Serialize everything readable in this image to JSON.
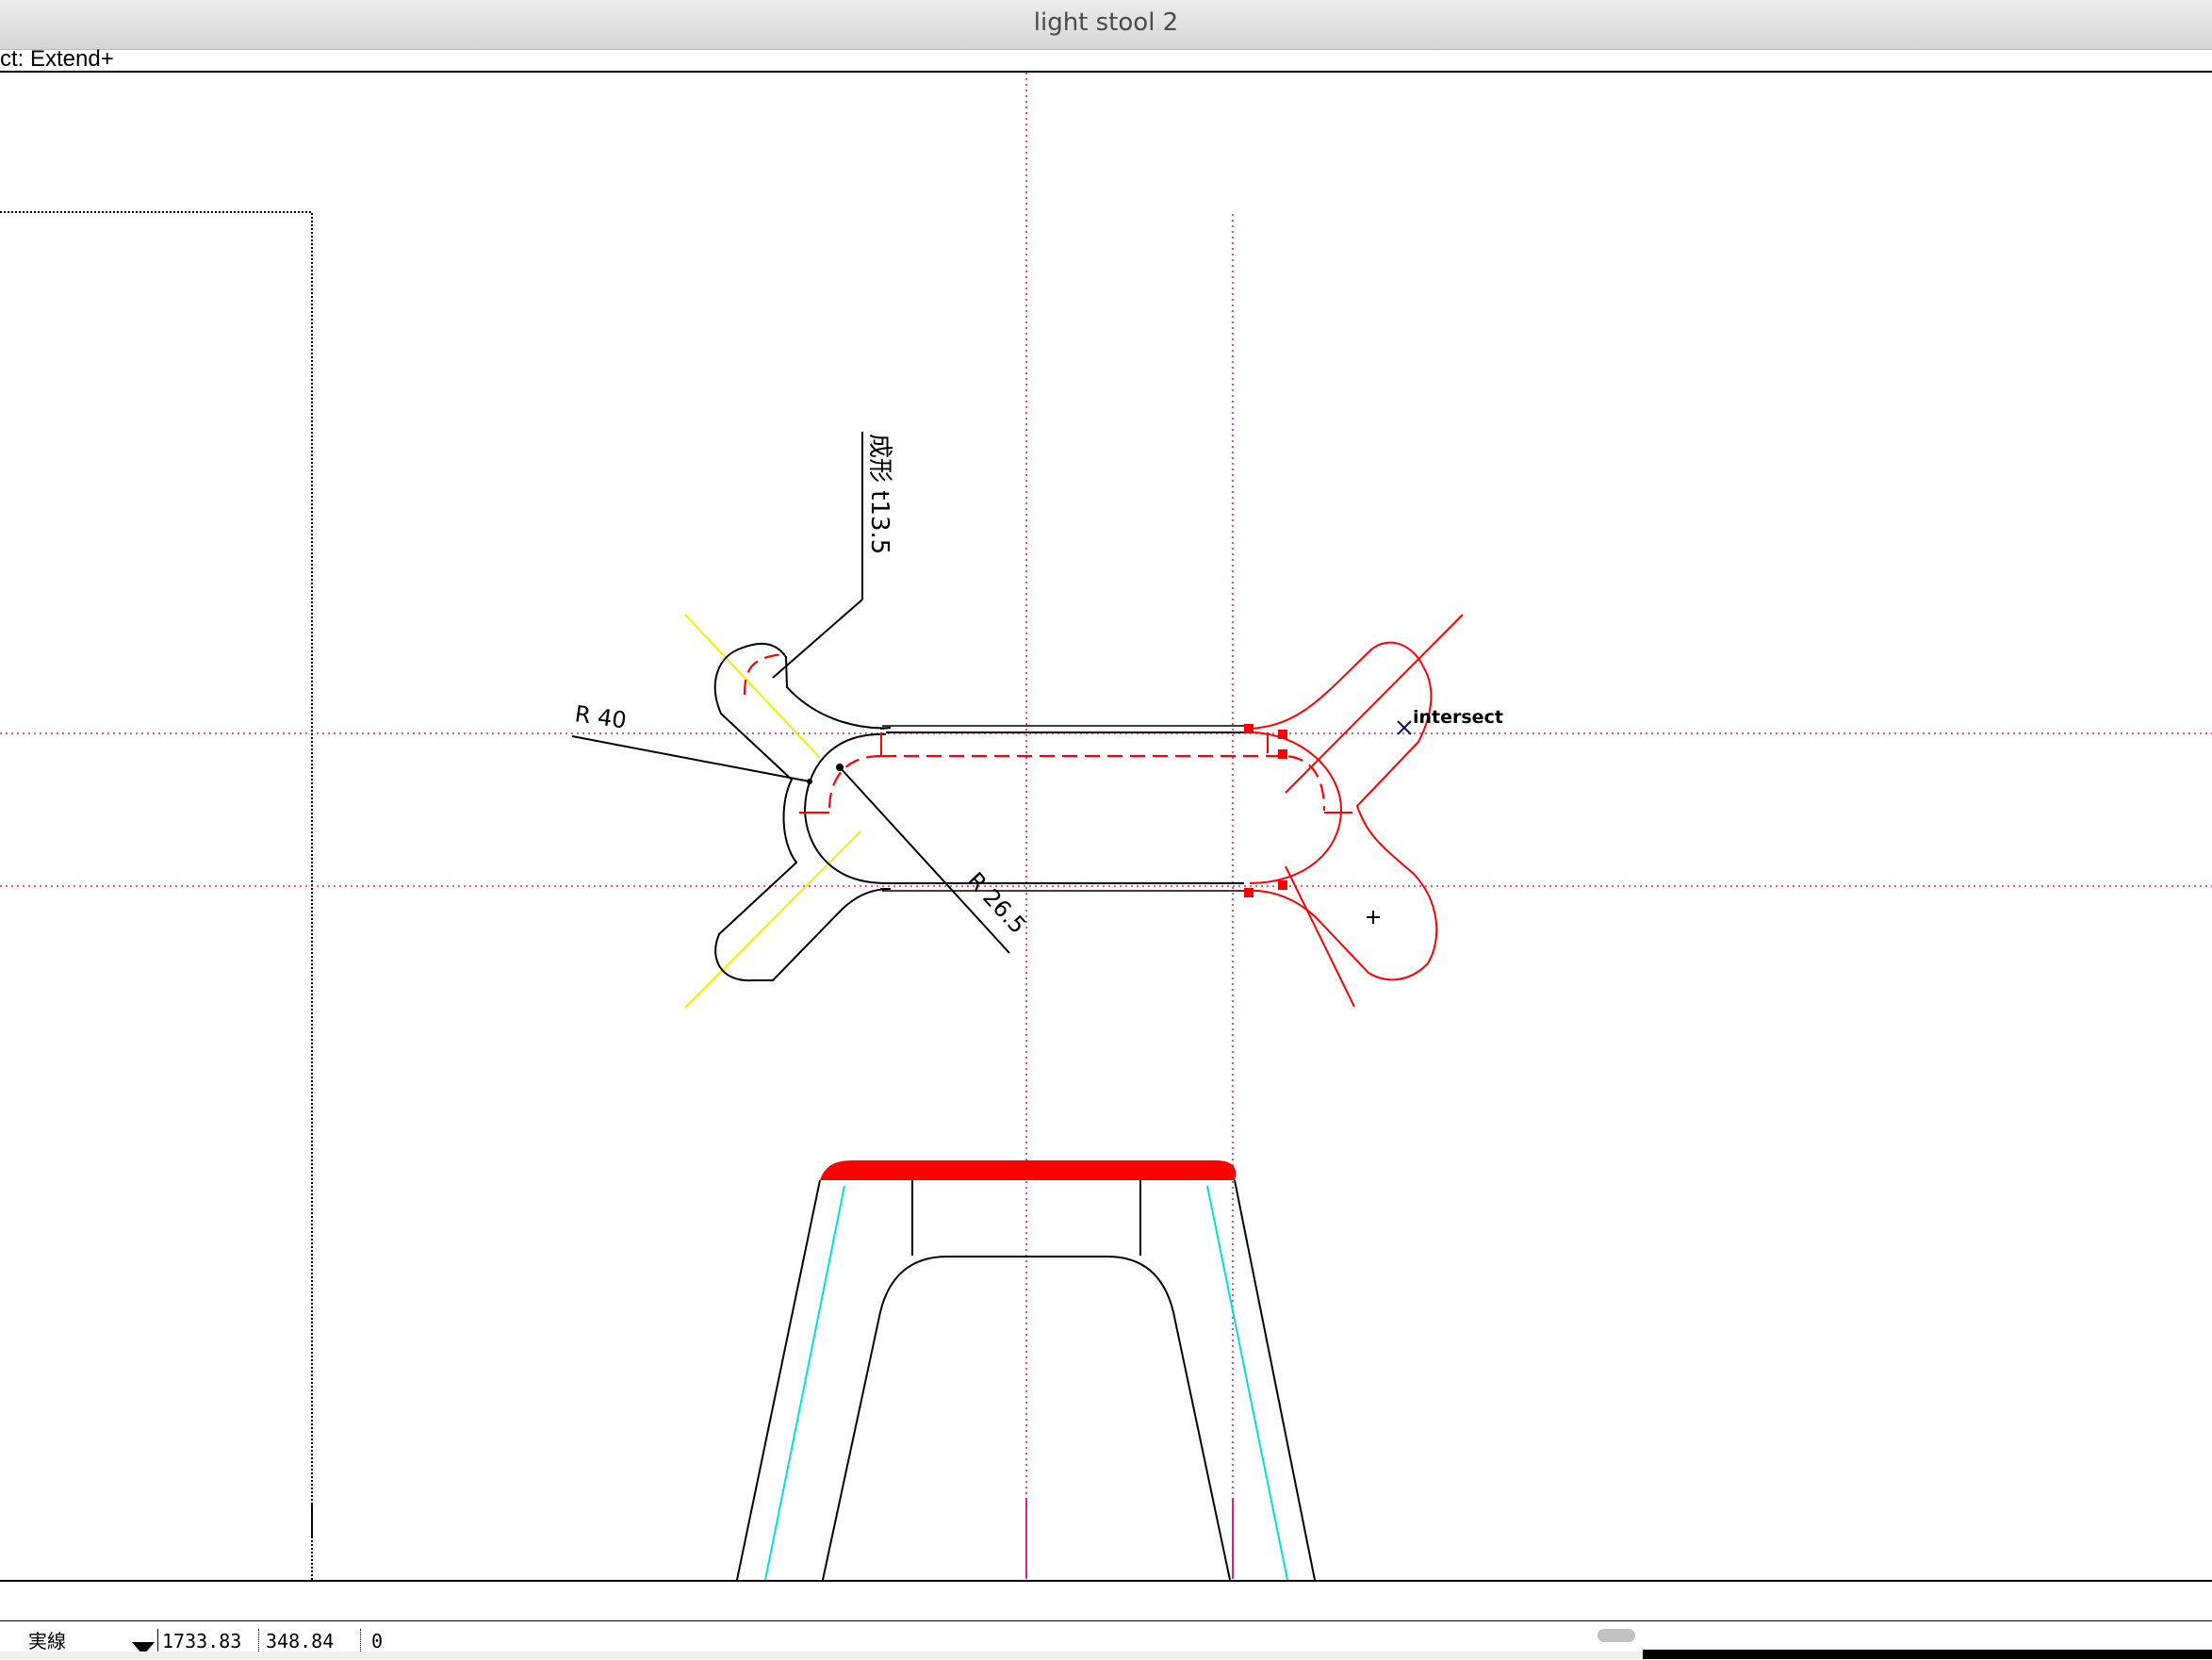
{
  "window": {
    "title": "light stool 2"
  },
  "command_line": {
    "text": "ct: Extend+"
  },
  "drawing": {
    "annotations": {
      "forming_note": "成形 t13.5",
      "radius_outer": "R 40",
      "radius_inner": "R 26.5",
      "snap_hint": "intersect"
    },
    "colors": {
      "normal": "#000000",
      "selected": "#ff0000",
      "guide": "#e0208a",
      "construction": "#f0f000",
      "inner_line": "#00e0e0"
    }
  },
  "status_bar": {
    "line_type": "実線",
    "x_coord": "1733.83",
    "y_coord": "348.84",
    "value": "0"
  },
  "icons": [
    "dropdown-arrow-icon",
    "crosshair-cursor-icon"
  ]
}
